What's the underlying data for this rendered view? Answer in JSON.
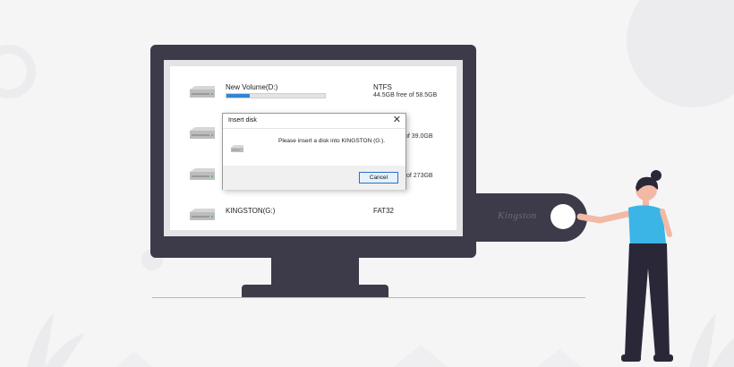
{
  "drives": [
    {
      "name": "New Volume(D:)",
      "filesystem": "NTFS",
      "free_text": "44.5GB free of 58.5GB",
      "used_fraction": 0.24
    },
    {
      "name": "",
      "filesystem": "",
      "free_text": "of 39.0GB",
      "used_fraction": null
    },
    {
      "name": "",
      "filesystem": "",
      "free_text": "of 273GB",
      "used_fraction": null
    },
    {
      "name": "KINGSTON(G:)",
      "filesystem": "FAT32",
      "free_text": "",
      "used_fraction": null
    }
  ],
  "dialog": {
    "title": "Insert disk",
    "close_glyph": "✕",
    "message": "Please insert a disk into KINGSTON (G:).",
    "cancel_label": "Cancel"
  },
  "usb": {
    "brand": "Kingston"
  },
  "colors": {
    "monitor": "#3d3a4a",
    "progress": "#2f86d3",
    "shirt": "#3bb4e6",
    "background": "#f5f5f6"
  },
  "icons": {
    "drive": "hard-drive-icon",
    "close": "close-icon"
  }
}
